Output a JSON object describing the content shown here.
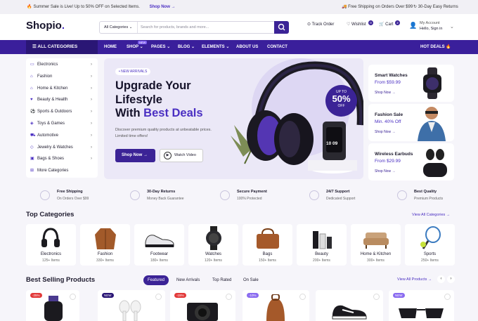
{
  "topbar": {
    "promo_text": "Summer Sale is Live! Up to 50% OFF on Selected Items.",
    "promo_link": "Shop Now →",
    "shipping": "Free Shipping on Orders Over $99",
    "returns": "30-Day Easy Returns"
  },
  "header": {
    "logo_main": "Shopio",
    "logo_dot": ".",
    "search_category": "All Categories",
    "search_placeholder": "Search for products, brands and more...",
    "track_order": "Track Order",
    "wishlist": "Wishlist",
    "wishlist_count": "0",
    "cart": "Cart",
    "cart_count": "2",
    "account_title": "My Account",
    "account_sub": "Hello, Sign in"
  },
  "nav": {
    "all_categories": "ALL CATEGORIES",
    "items": [
      "HOME",
      "SHOP",
      "PAGES",
      "BLOG",
      "ELEMENTS",
      "ABOUT US",
      "CONTACT"
    ],
    "new_tag": "NEW",
    "hot_deals": "HOT DEALS"
  },
  "sidebar": {
    "items": [
      "Electronics",
      "Fashion",
      "Home & Kitchen",
      "Beauty & Health",
      "Sports & Outdoors",
      "Toys & Games",
      "Automotive",
      "Jewelry & Watches",
      "Bags & Shoes",
      "More Categories"
    ]
  },
  "hero": {
    "tag": "NEW ARRIVALS",
    "line1": "Upgrade Your",
    "line2": "Lifestyle",
    "line3_pre": "With ",
    "line3_accent": "Best Deals",
    "desc": "Discover premium quality products at unbeatable prices. Limited time offers!",
    "shop_btn": "Shop Now →",
    "watch_btn": "Watch Video",
    "badge_top": "UP TO",
    "badge_value": "50%",
    "badge_bottom": "OFF",
    "watch_display": "10 09"
  },
  "promos": [
    {
      "title": "Smart Watches",
      "price": "From $59.99",
      "link": "Shop Now →"
    },
    {
      "title": "Fashion Sale",
      "price": "Min. 40% Off",
      "link": "Shop Now →"
    },
    {
      "title": "Wireless Earbuds",
      "price": "From $29.99",
      "link": "Shop Now →"
    }
  ],
  "features": [
    {
      "title": "Free Shipping",
      "sub": "On Orders Over $99"
    },
    {
      "title": "30-Day Returns",
      "sub": "Money Back Guarantee"
    },
    {
      "title": "Secure Payment",
      "sub": "100% Protected"
    },
    {
      "title": "24/7 Support",
      "sub": "Dedicated Support"
    },
    {
      "title": "Best Quality",
      "sub": "Premium Products"
    }
  ],
  "top_categories": {
    "title": "Top Categories",
    "view_all": "View All Categories →",
    "items": [
      {
        "name": "Electronics",
        "count": "125+ Items"
      },
      {
        "name": "Fashion",
        "count": "330+ Items"
      },
      {
        "name": "Footwear",
        "count": "180+ Items"
      },
      {
        "name": "Watches",
        "count": "120+ Items"
      },
      {
        "name": "Bags",
        "count": "150+ Items"
      },
      {
        "name": "Beauty",
        "count": "200+ Items"
      },
      {
        "name": "Home & Kitchen",
        "count": "300+ Items"
      },
      {
        "name": "Sports",
        "count": "250+ Items"
      }
    ]
  },
  "best_selling": {
    "title": "Best Selling Products",
    "tabs": [
      "Featured",
      "New Arrivals",
      "Top Rated",
      "On Sale"
    ],
    "view_all": "View All Products →",
    "badges": [
      "-25%",
      "NEW",
      "-15%",
      "-10%",
      "",
      "NEW"
    ]
  },
  "colors": {
    "brand": "#3b2396",
    "accent": "#4a2fc2",
    "sale": "#e23a3a"
  }
}
